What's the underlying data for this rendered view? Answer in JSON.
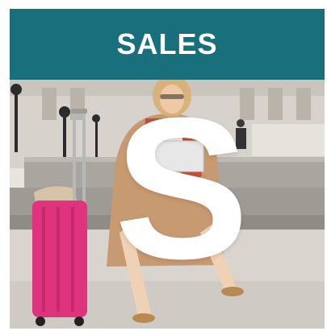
{
  "header": {
    "title": "SALES"
  },
  "hero": {
    "letter": "S"
  },
  "colors": {
    "header_bg": "#196f7c",
    "header_text": "#ffffff",
    "suitcase": "#e0337e",
    "coat": "#c89a72"
  }
}
